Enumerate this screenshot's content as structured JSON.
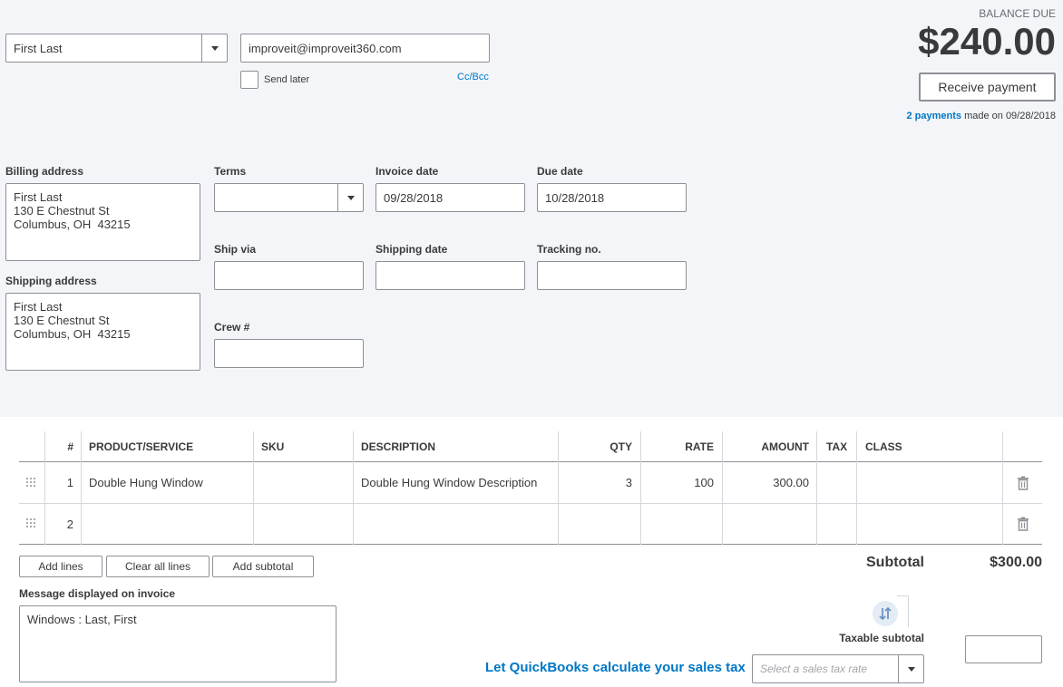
{
  "customer": {
    "name": "First Last",
    "email": "improveit@improveit360.com",
    "send_later": "Send later",
    "ccbcc": "Cc/Bcc"
  },
  "balance": {
    "label": "BALANCE DUE",
    "amount": "$240.00",
    "receive_button": "Receive payment",
    "payments_link": "2 payments",
    "payments_text": "made on 09/28/2018"
  },
  "billing": {
    "label": "Billing address",
    "lines": [
      "First Last",
      "130 E Chestnut St",
      "Columbus, OH  43215"
    ]
  },
  "shipping": {
    "label": "Shipping address",
    "lines": [
      "First Last",
      "130 E Chestnut St",
      "Columbus, OH  43215"
    ]
  },
  "terms": {
    "label": "Terms",
    "value": ""
  },
  "invoice_date": {
    "label": "Invoice date",
    "value": "09/28/2018"
  },
  "due_date": {
    "label": "Due date",
    "value": "10/28/2018"
  },
  "ship_via": {
    "label": "Ship via",
    "value": ""
  },
  "shipping_date": {
    "label": "Shipping date",
    "value": ""
  },
  "tracking": {
    "label": "Tracking no.",
    "value": ""
  },
  "crew": {
    "label": "Crew #",
    "value": ""
  },
  "table": {
    "headers": {
      "num": "#",
      "product": "PRODUCT/SERVICE",
      "sku": "SKU",
      "description": "DESCRIPTION",
      "qty": "QTY",
      "rate": "RATE",
      "amount": "AMOUNT",
      "tax": "TAX",
      "class": "CLASS"
    },
    "rows": [
      {
        "num": "1",
        "product": "Double Hung Window",
        "sku": "",
        "description": "Double Hung Window Description",
        "qty": "3",
        "rate": "100",
        "amount": "300.00",
        "tax": "",
        "class": ""
      },
      {
        "num": "2",
        "product": "",
        "sku": "",
        "description": "",
        "qty": "",
        "rate": "",
        "amount": "",
        "tax": "",
        "class": ""
      }
    ]
  },
  "actions": {
    "add_lines": "Add lines",
    "clear_lines": "Clear all lines",
    "add_subtotal": "Add subtotal"
  },
  "subtotal": {
    "label": "Subtotal",
    "value": "$300.00"
  },
  "message": {
    "label": "Message displayed on invoice",
    "value": "Windows : Last, First"
  },
  "tax": {
    "taxable_subtotal": "Taxable subtotal",
    "qb_link": "Let QuickBooks calculate your sales tax",
    "rate_placeholder": "Select a sales tax rate",
    "taxable_value": ""
  },
  "colors": {
    "link": "#0077c5",
    "text": "#393a3d",
    "border": "#8d9096",
    "panel_bg": "#f4f5f8"
  },
  "icons": [
    "chevron-down-icon",
    "checkbox-icon",
    "drag-handle-icon",
    "trash-icon",
    "sort-toggle-icon"
  ]
}
